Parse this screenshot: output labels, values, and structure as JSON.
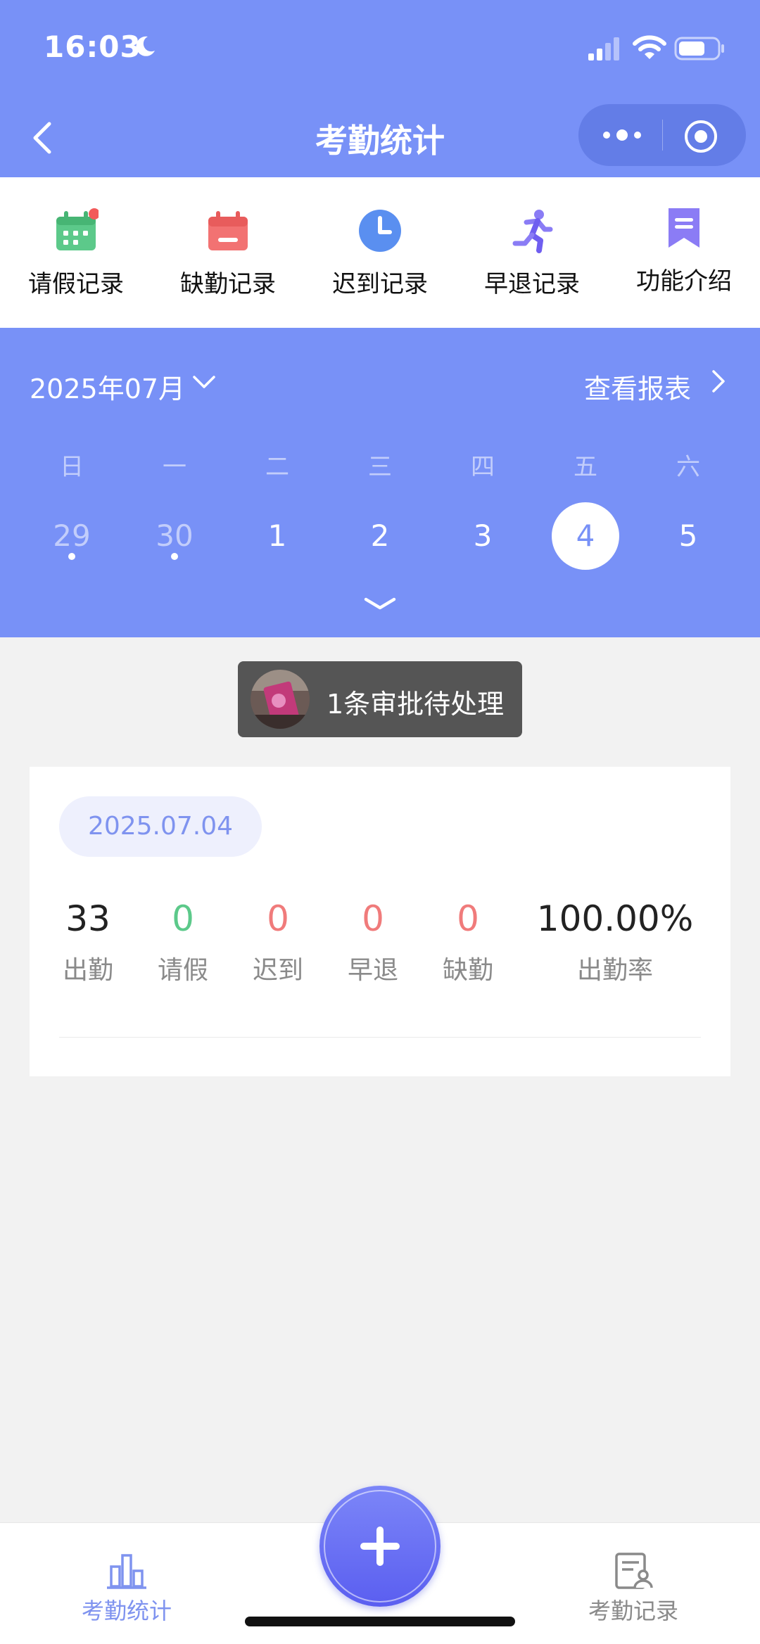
{
  "status_bar": {
    "time": "16:03"
  },
  "nav": {
    "title": "考勤统计"
  },
  "quick_actions": [
    {
      "label": "请假记录",
      "icon": "calendar-grid-icon"
    },
    {
      "label": "缺勤记录",
      "icon": "calendar-minus-icon"
    },
    {
      "label": "迟到记录",
      "icon": "clock-icon"
    },
    {
      "label": "早退记录",
      "icon": "running-person-icon"
    },
    {
      "label": "功能介绍",
      "icon": "bookmark-icon"
    }
  ],
  "calendar": {
    "month": "2025年07月",
    "report_link": "查看报表",
    "weekdays": [
      "日",
      "一",
      "二",
      "三",
      "四",
      "五",
      "六"
    ],
    "days": [
      "29",
      "30",
      "1",
      "2",
      "3",
      "4",
      "5"
    ],
    "selected_day": "4"
  },
  "toast": {
    "message": "1条审批待处理"
  },
  "summary": {
    "date": "2025.07.04",
    "stats": [
      {
        "value": "33",
        "label": "出勤"
      },
      {
        "value": "0",
        "label": "请假"
      },
      {
        "value": "0",
        "label": "迟到"
      },
      {
        "value": "0",
        "label": "早退"
      },
      {
        "value": "0",
        "label": "缺勤"
      },
      {
        "value": "100.00%",
        "label": "出勤率"
      }
    ]
  },
  "tabbar": {
    "left_label": "考勤统计",
    "right_label": "考勤记录"
  },
  "colors": {
    "primary": "#7891f7",
    "green": "#5cc98a",
    "red": "#f07b7b",
    "inactive": "#8a8a8a"
  }
}
